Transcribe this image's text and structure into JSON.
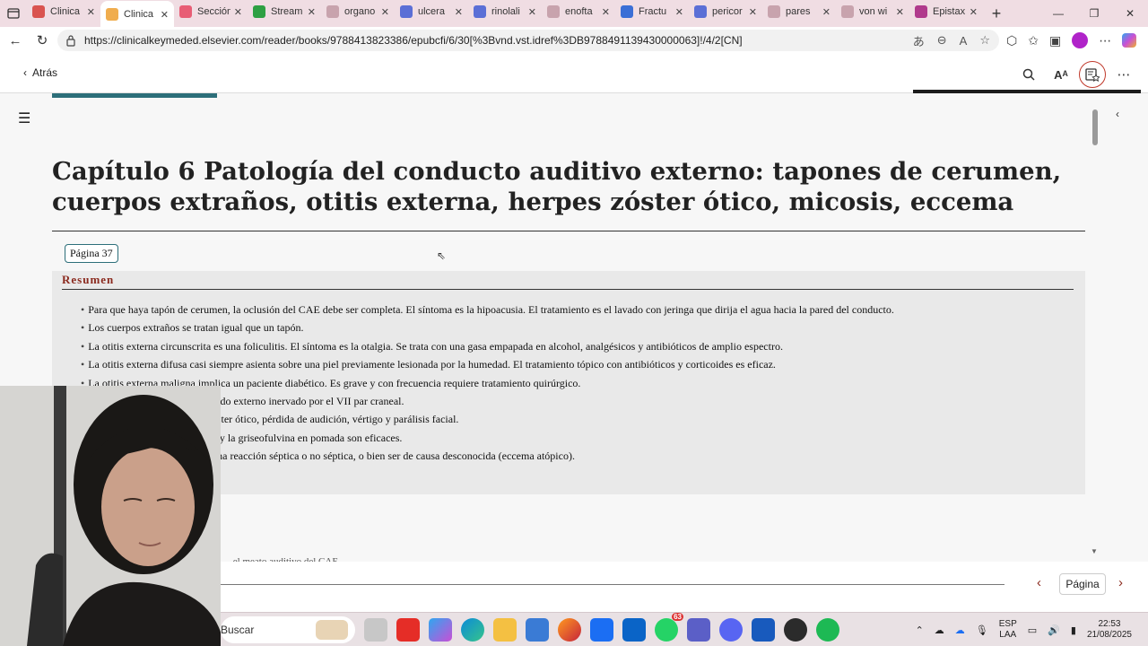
{
  "browser": {
    "tabs": [
      {
        "title": "Clinica",
        "color": "#d9534f",
        "active": false
      },
      {
        "title": "Clinica",
        "color": "#f0ad4e",
        "active": true
      },
      {
        "title": "Sección",
        "color": "#e85d75",
        "active": false
      },
      {
        "title": "Stream",
        "color": "#2ea043",
        "active": false
      },
      {
        "title": "organo",
        "color": "#c8a3ad",
        "active": false
      },
      {
        "title": "ulcera",
        "color": "#5b6fd6",
        "active": false
      },
      {
        "title": "rinolali",
        "color": "#5b6fd6",
        "active": false
      },
      {
        "title": "enofta",
        "color": "#c8a3ad",
        "active": false
      },
      {
        "title": "Fractu",
        "color": "#3b6fd6",
        "active": false
      },
      {
        "title": "pericor",
        "color": "#5b6fd6",
        "active": false
      },
      {
        "title": "pares",
        "color": "#c8a3ad",
        "active": false
      },
      {
        "title": "von wi",
        "color": "#c8a3ad",
        "active": false
      },
      {
        "title": "Epistax",
        "color": "#b03a8c",
        "active": false
      }
    ],
    "url": "https://clinicalkeymeded.elsevier.com/reader/books/9788413823386/epubcfi/6/30[%3Bvnd.vst.idref%3DB9788491139430000063]!/4/2[CN]"
  },
  "reader": {
    "back_label": "Atrás",
    "tooltip": "Destacados, Notas, Marcadores y Fichas educativas",
    "chapter_title": "Capítulo 6 Patología del conducto auditivo externo: tapones de cerumen, cuerpos extraños, otitis externa, herpes zóster ótico, micosis, eccema",
    "page_badge": "Página 37",
    "summary_heading": "Resumen",
    "summary_items": [
      "Para que haya tapón de cerumen, la oclusión del CAE debe ser completa. El síntoma es la hipoacusia. El tratamiento es el lavado con jeringa que dirija el agua hacia la pared del conducto.",
      "Los cuerpos extraños se tratan igual que un tapón.",
      "La otitis externa circunscrita es una foliculitis. El síntoma es la otalgia. Se trata con una gasa empapada en alcohol, analgésicos y antibióticos de amplio espectro.",
      "La otitis externa difusa casi siempre asienta sobre una piel previamente lesionada por la humedad. El tratamiento tópico con antibióticos y corticoides es eficaz.",
      "La otitis externa maligna implica un paciente diabético. Es grave y con frecuencia requiere tratamiento quirúrgico.",
      "a en el territorio cutáneo del oído externo inervado por el VII par craneal.",
      "nt suma, a los síntomas del zóster ótico, pérdida de audición, vértigo y parálisis facial.",
      "teriza por prurito. La nistatina y la griseofulvina en pomada son eficaces.",
      "nso prurito, puede deberse a una reacción séptica o no séptica, o bien ser de causa desconocida (eccema atópico)."
    ],
    "progress_fraction": 0.16,
    "page_button": "Página"
  },
  "taskbar": {
    "search_label": "Buscar",
    "lang_line1": "ESP",
    "lang_line2": "LAA",
    "time": "22:53",
    "date": "21/08/2025",
    "badge_count": "63"
  },
  "colors": {
    "accent_teal": "#2d6f7a",
    "heading_red": "#8b2a1e",
    "tabstrip_pink": "#f0dde3"
  }
}
